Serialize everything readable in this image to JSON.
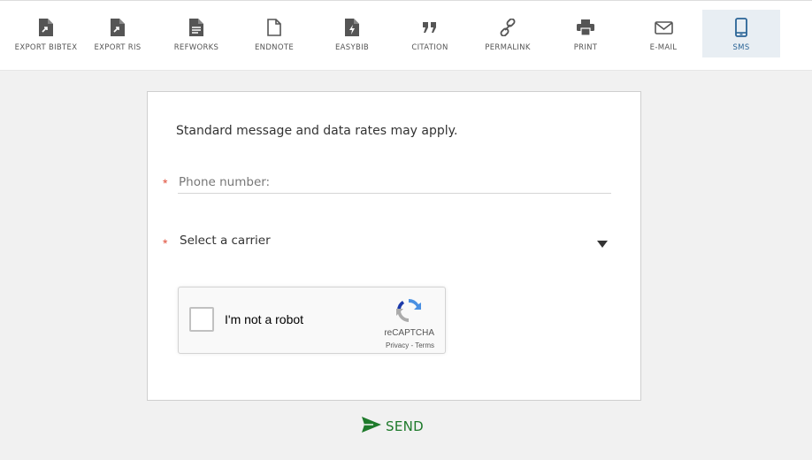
{
  "toolbar": {
    "items": [
      {
        "label": "EXPORT BIBTEX",
        "icon": "export-file-icon"
      },
      {
        "label": "EXPORT RIS",
        "icon": "export-file-icon"
      },
      {
        "label": "REFWORKS",
        "icon": "document-lines-icon"
      },
      {
        "label": "ENDNOTE",
        "icon": "blank-document-icon"
      },
      {
        "label": "EASYBIB",
        "icon": "easybib-icon"
      },
      {
        "label": "CITATION",
        "icon": "quote-icon"
      },
      {
        "label": "PERMALINK",
        "icon": "link-icon"
      },
      {
        "label": "PRINT",
        "icon": "printer-icon"
      },
      {
        "label": "E-MAIL",
        "icon": "envelope-icon"
      },
      {
        "label": "SMS",
        "icon": "mobile-phone-icon"
      }
    ],
    "active": "SMS"
  },
  "form": {
    "notice": "Standard message and data rates may apply.",
    "required_marker": "*",
    "phone_placeholder": "Phone number:",
    "phone_value": "",
    "carrier_selected": "Select a carrier"
  },
  "captcha": {
    "label": "I'm not a robot",
    "brand": "reCAPTCHA",
    "privacy": "Privacy",
    "separator": " - ",
    "terms": "Terms",
    "checked": false
  },
  "send": {
    "label": "SEND",
    "icon": "send-arrow-icon"
  },
  "colors": {
    "required": "#e04e3a",
    "send": "#1e7a2b",
    "active_tab_bg": "#e8eef3",
    "active_tab_text": "#2a6496"
  }
}
